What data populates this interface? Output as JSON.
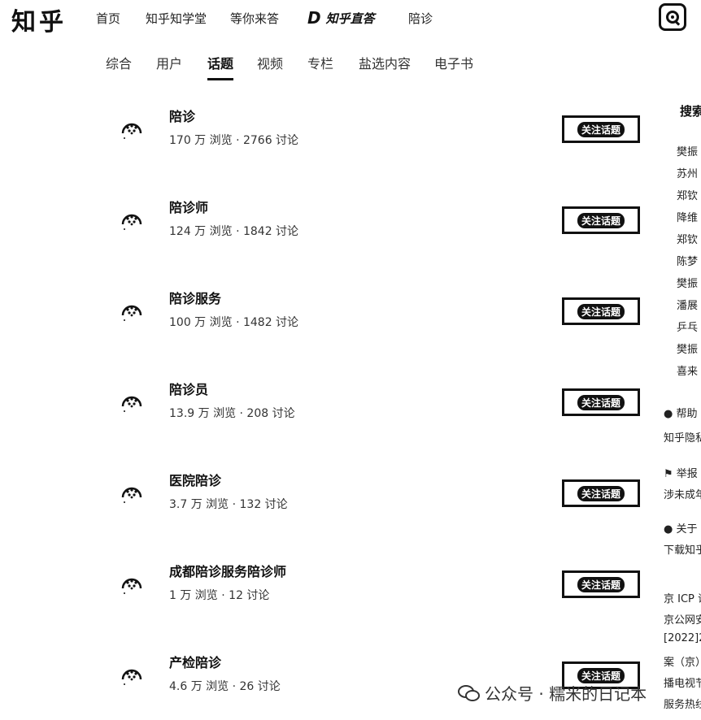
{
  "header": {
    "logo": "知乎",
    "nav": [
      "首页",
      "知乎知学堂",
      "等你来答",
      "知乎直答"
    ],
    "zhida_mark": "D",
    "search_query": "陪诊"
  },
  "tabs": [
    "综合",
    "用户",
    "话题",
    "视频",
    "专栏",
    "盐选内容",
    "电子书"
  ],
  "active_tab": "话题",
  "follow_label": "关注话题",
  "topics": [
    {
      "name": "陪诊",
      "stats": "170 万 浏览 · 2766 讨论"
    },
    {
      "name": "陪诊师",
      "stats": "124 万 浏览 · 1842 讨论"
    },
    {
      "name": "陪诊服务",
      "stats": "100 万 浏览 · 1482 讨论"
    },
    {
      "name": "陪诊员",
      "stats": "13.9 万 浏览 · 208 讨论"
    },
    {
      "name": "医院陪诊",
      "stats": "3.7 万 浏览 · 132 讨论"
    },
    {
      "name": "成都陪诊服务陪诊师",
      "stats": "1 万 浏览 · 12 讨论"
    },
    {
      "name": "产检陪诊",
      "stats": "4.6 万 浏览 · 26 讨论"
    }
  ],
  "sidebar": {
    "heading": "搜索",
    "trending": [
      "樊振",
      "苏州",
      "郑钦",
      "降维",
      "郑钦",
      "陈梦",
      "樊振",
      "潘展",
      "乒乓",
      "樊振",
      "喜来"
    ],
    "help_title": "帮助",
    "help_text": "知乎隐私",
    "report_title": "举报",
    "report_text": "涉未成年",
    "about_title": "关于",
    "about_text": "下载知乎",
    "footer": [
      "京 ICP 证",
      "京公网安",
      "[2022]2",
      "案（京）",
      "播电视节",
      "服务热线"
    ]
  },
  "watermark": "公众号 · 糯米的日记本"
}
